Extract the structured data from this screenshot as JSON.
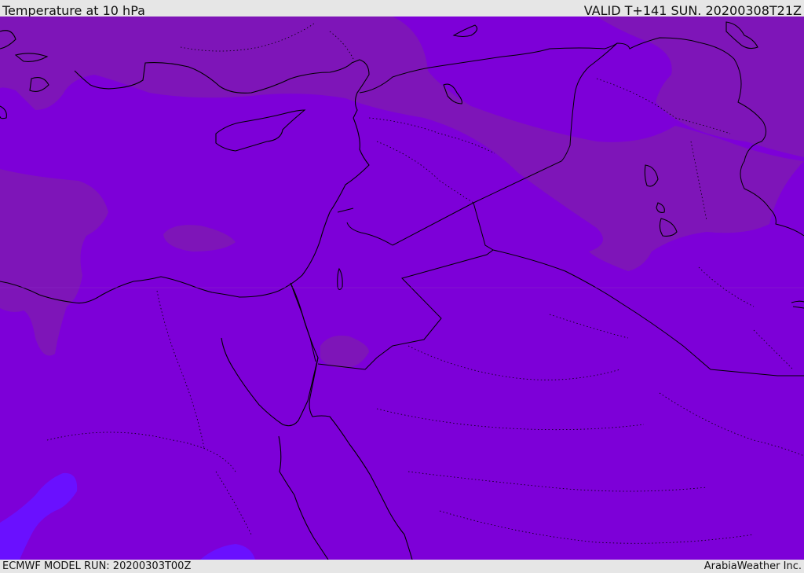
{
  "header": {
    "title": "Temperature at 10 hPa",
    "valid": "VALID T+141 SUN. 20200308T21Z"
  },
  "footer": {
    "model_run": "ECMWF MODEL RUN: 20200303T00Z",
    "brand": "ArabiaWeather Inc."
  },
  "colors": {
    "base_fill": "#7d00d8",
    "warm_zone": "#7e15b8",
    "cool_zone": "#6a10ff",
    "coastline": "#000000",
    "border": "#000000",
    "page_background": "#e6e6e6"
  }
}
